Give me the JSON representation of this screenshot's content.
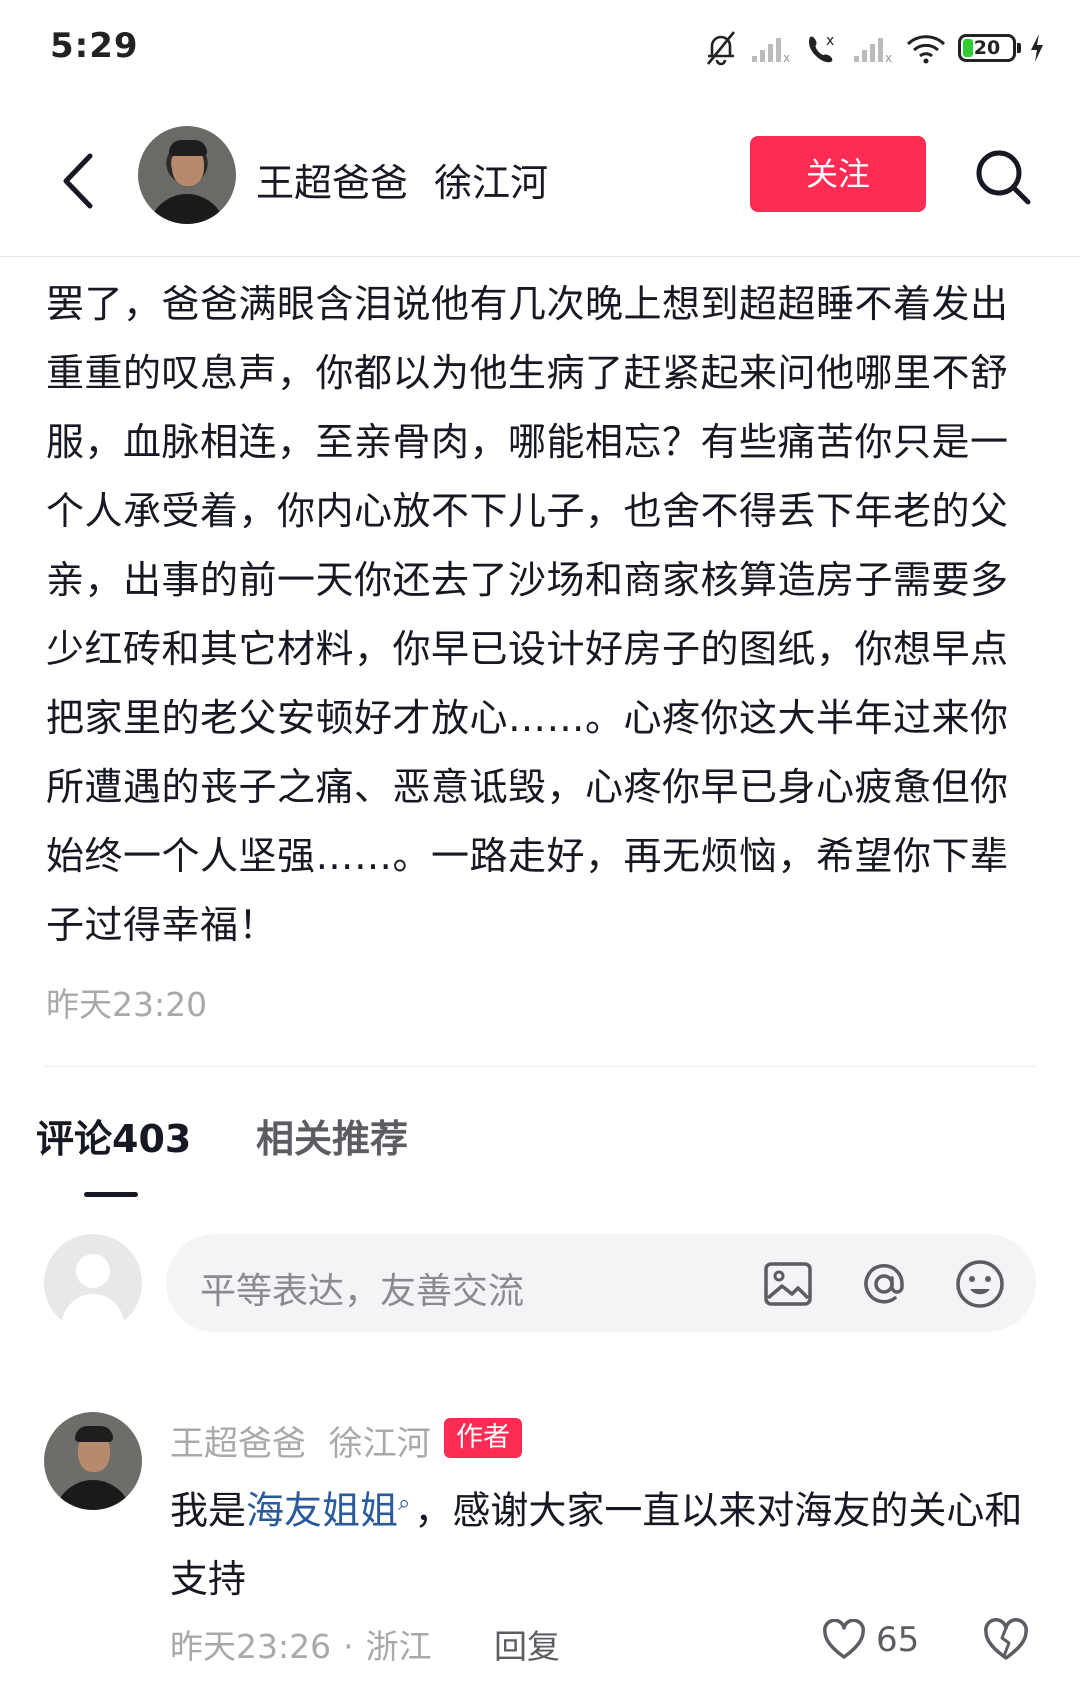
{
  "status_bar": {
    "time": "5:29",
    "battery": "20"
  },
  "header": {
    "name": "王超爸爸 徐江河",
    "follow_label": "关注"
  },
  "post": {
    "text": "罢了，爸爸满眼含泪说他有几次晚上想到超超睡不着发出重重的叹息声，你都以为他生病了赶紧起来问他哪里不舒服，血脉相连，至亲骨肉，哪能相忘？有些痛苦你只是一个人承受着，你内心放不下儿子，也舍不得丢下年老的父亲，出事的前一天你还去了沙场和商家核算造房子需要多少红砖和其它材料，你早已设计好房子的图纸，你想早点把家里的老父安顿好才放心……。心疼你这大半年过来你所遭遇的丧子之痛、恶意诋毁，心疼你早已身心疲惫但你始终一个人坚强……。一路走好，再无烦恼，希望你下辈子过得幸福！",
    "time": "昨天23:20"
  },
  "tabs": {
    "comments": "评论403",
    "related": "相关推荐"
  },
  "comment_input": {
    "placeholder": "平等表达，友善交流"
  },
  "comment": {
    "author": "王超爸爸 徐江河",
    "badge": "作者",
    "text_before": "我是",
    "mention": "海友姐姐",
    "text_after": "，感谢大家一直以来对海友的关心和支持",
    "time": "昨天23:26",
    "location": "浙江",
    "dot": "·",
    "reply_label": "回复",
    "like_count": "65"
  },
  "colors": {
    "accent": "#fe2c55",
    "mention": "#2a5a9a",
    "muted": "#a8a9ad"
  }
}
